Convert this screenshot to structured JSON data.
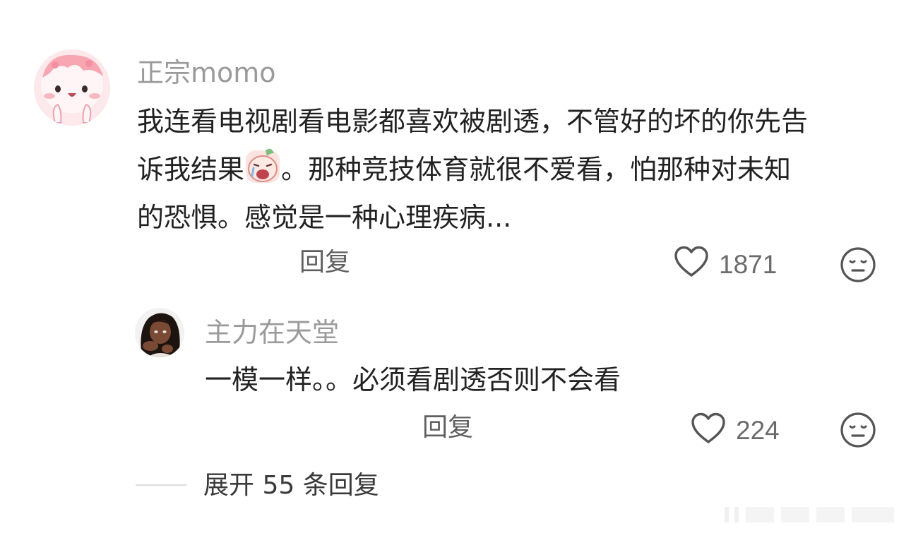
{
  "comment": {
    "username": "正宗momo",
    "text_part1": "我连看电视剧看电影都喜欢被剧透，不管好的坏的你先告",
    "text_part2a": "诉我结果",
    "text_part2b": "。那种竞技体育就很不爱看，怕那种对未知",
    "text_part3": "的恐惧。感觉是一种心理疾病...",
    "inline_emoji": "crying-face-emoji",
    "reply_label": "回复",
    "like_count": "1871",
    "like_icon": "heart-outline-icon",
    "dislike_icon": "meh-face-icon",
    "avatar": "pink-cartoon-avatar"
  },
  "reply": {
    "username": "主力在天堂",
    "text": "一模一样。。必须看剧透否则不会看",
    "reply_label": "回复",
    "like_count": "224",
    "like_icon": "heart-outline-icon",
    "dislike_icon": "meh-face-icon",
    "avatar": "anime-girl-avatar"
  },
  "expand_replies": "展开 55 条回复",
  "colors": {
    "username": "#9a9a9a",
    "text": "#222222",
    "secondary": "#5f5f5f"
  }
}
